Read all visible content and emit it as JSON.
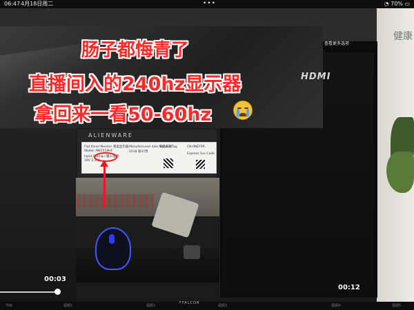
{
  "status_bar": {
    "time": "06:47",
    "date": "4月18日周二",
    "dots": "•••",
    "battery": "70%"
  },
  "caption": {
    "line1": "肠子都悔青了",
    "line2": "直播间入的240hz显示器",
    "line3": "拿回来一看50-60hz"
  },
  "photo": {
    "brand": "ALIENWARE",
    "hdmi": "HDMI",
    "wall_text": "健康",
    "screen_sub": "查看更多选项",
    "tv_brand": "FFALCON",
    "label_lines": [
      "Flat Panel Monitor 液晶显示器",
      "Model: AW2518HF",
      "Input Rating / 输入电源:",
      "19V 2.37A",
      "Manufactured date 制造日期",
      "2018 第47周",
      "CN-0NEF9R",
      "Service Tag",
      "Express Svc Code"
    ]
  },
  "video": {
    "left_time": "00:03",
    "right_time": "00:12",
    "progress": 0.14
  },
  "bottom_bar": {
    "items": [
      "节目",
      "视频1",
      "视频2",
      "视频3",
      "视频4",
      "视频5"
    ]
  }
}
